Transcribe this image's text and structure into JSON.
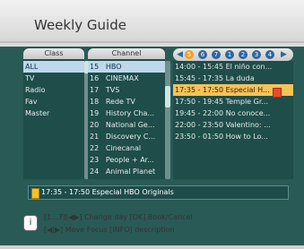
{
  "header": {
    "title": "Weekly Guide"
  },
  "class_pane": {
    "header": "Class",
    "items": [
      "ALL",
      "TV",
      "Radio",
      "Fav",
      "Master"
    ]
  },
  "channel_pane": {
    "header": "Channel",
    "items": [
      {
        "num": "15",
        "name": "HBO"
      },
      {
        "num": "16",
        "name": "CINEMAX"
      },
      {
        "num": "17",
        "name": "TVS"
      },
      {
        "num": "18",
        "name": "Rede TV"
      },
      {
        "num": "19",
        "name": "History Cha..."
      },
      {
        "num": "20",
        "name": "National Ge..."
      },
      {
        "num": "21",
        "name": "Discovery C..."
      },
      {
        "num": "22",
        "name": "Cinecanal"
      },
      {
        "num": "23",
        "name": "People + Ar..."
      },
      {
        "num": "24",
        "name": "Animal Planet"
      }
    ]
  },
  "day_selector": {
    "days": [
      "5",
      "6",
      "7",
      "1",
      "2",
      "3",
      "4"
    ],
    "active_index": 0,
    "left_arrow": "◀",
    "right_arrow": "▶"
  },
  "schedule_pane": {
    "items": [
      "14:00 - 15:45  El niño con...",
      "15:45 - 17:35  La duda",
      "17:35 - 17:50  Especial H...",
      "17:50 - 19:45  Temple Gr...",
      "19:45 - 22:00  No conoce...",
      "22:00 - 23:50  Valentino: ...",
      "23:50 - 01:50  How to Lo..."
    ],
    "selected_index": 2
  },
  "status_bar": {
    "text": "17:35 - 17:50  Especial HBO Originals"
  },
  "help": {
    "info_label": "i",
    "line1": "[1...7][◀▶] Change day  [OK] Book/Cancel",
    "line2": "[◀|▶] Move Focus  [INFO] description"
  },
  "colors": {
    "panel_bg": "#2a5a56",
    "selection_blue": "#bcd8ea",
    "selection_orange": "#f6c25a",
    "active_day": "#f2a11c"
  }
}
